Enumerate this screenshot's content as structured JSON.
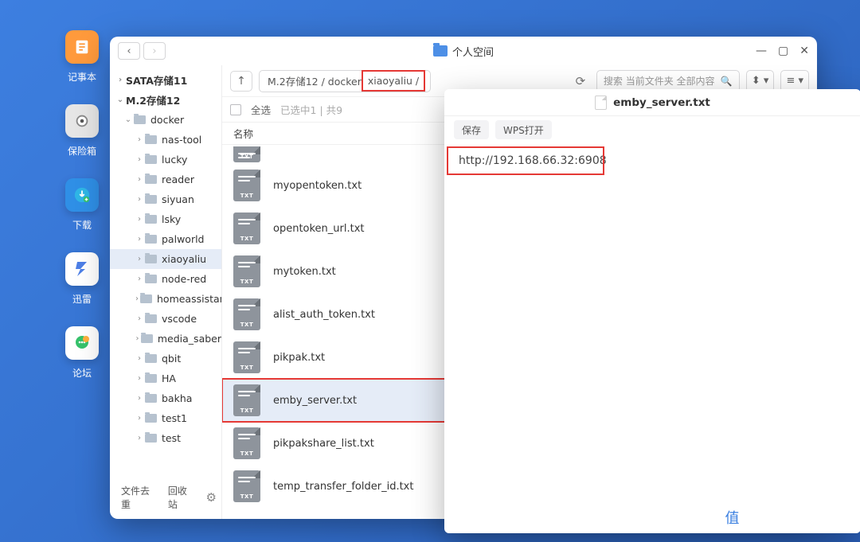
{
  "dock": [
    {
      "label": "记事本",
      "icon": "notes",
      "bg": "#ff9a3c"
    },
    {
      "label": "保险箱",
      "icon": "safe",
      "bg": "#e6e6e6"
    },
    {
      "label": "下载",
      "icon": "download",
      "bg": "#2f8fe6"
    },
    {
      "label": "迅雷",
      "icon": "xunlei",
      "bg": "#ffffff"
    },
    {
      "label": "论坛",
      "icon": "forum",
      "bg": "#ffffff"
    }
  ],
  "window": {
    "title": "个人空间",
    "breadcrumb": {
      "seg1": "M.2存储12 / docker",
      "seg2": "xiaoyaliu /"
    },
    "search_placeholder": "搜索 当前文件夹 全部内容",
    "select_all": "全选",
    "select_info": "已选中1 | 共9",
    "column_header": "名称",
    "footer": {
      "a": "文件去重",
      "b": "回收站"
    }
  },
  "tree": [
    {
      "level": 1,
      "chev": "›",
      "label": "SATA存储11",
      "bold": true
    },
    {
      "level": 1,
      "chev": "⌄",
      "label": "M.2存储12",
      "bold": true
    },
    {
      "level": 2,
      "chev": "⌄",
      "label": "docker"
    },
    {
      "level": 3,
      "chev": "›",
      "label": "nas-tool"
    },
    {
      "level": 3,
      "chev": "›",
      "label": "lucky"
    },
    {
      "level": 3,
      "chev": "›",
      "label": "reader"
    },
    {
      "level": 3,
      "chev": "›",
      "label": "siyuan"
    },
    {
      "level": 3,
      "chev": "›",
      "label": "lsky"
    },
    {
      "level": 3,
      "chev": "›",
      "label": "palworld"
    },
    {
      "level": 3,
      "chev": "›",
      "label": "xiaoyaliu",
      "selected": true
    },
    {
      "level": 3,
      "chev": "›",
      "label": "node-red"
    },
    {
      "level": 3,
      "chev": "›",
      "label": "homeassistant"
    },
    {
      "level": 3,
      "chev": "›",
      "label": "vscode"
    },
    {
      "level": 3,
      "chev": "›",
      "label": "media_saber"
    },
    {
      "level": 3,
      "chev": "›",
      "label": "qbit"
    },
    {
      "level": 3,
      "chev": "›",
      "label": "HA"
    },
    {
      "level": 3,
      "chev": "›",
      "label": "bakha"
    },
    {
      "level": 3,
      "chev": "›",
      "label": "test1"
    },
    {
      "level": 3,
      "chev": "›",
      "label": "test"
    }
  ],
  "files": [
    {
      "name": ""
    },
    {
      "name": "myopentoken.txt"
    },
    {
      "name": "opentoken_url.txt"
    },
    {
      "name": "mytoken.txt"
    },
    {
      "name": "alist_auth_token.txt"
    },
    {
      "name": "pikpak.txt"
    },
    {
      "name": "emby_server.txt",
      "selected": true,
      "highlight": true
    },
    {
      "name": "pikpakshare_list.txt"
    },
    {
      "name": "temp_transfer_folder_id.txt"
    }
  ],
  "preview": {
    "title": "emby_server.txt",
    "btn_save": "保存",
    "btn_wps": "WPS打开",
    "content": "http://192.168.66.32:6908"
  },
  "watermark": "什么值得买"
}
